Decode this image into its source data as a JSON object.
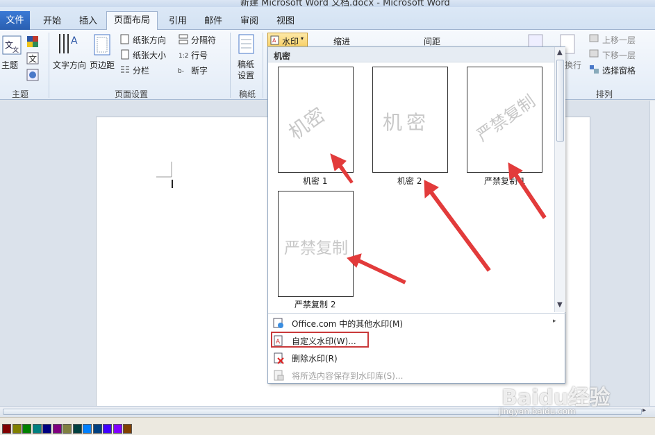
{
  "window": {
    "title": "新建 Microsoft Word 文档.docx - Microsoft Word"
  },
  "tabs": {
    "file": "文件",
    "home": "开始",
    "insert": "插入",
    "page_layout": "页面布局",
    "references": "引用",
    "mailings": "邮件",
    "review": "审阅",
    "view": "视图"
  },
  "ribbon": {
    "theme": {
      "theme_button": "主题",
      "group_label": "主题"
    },
    "page_setup": {
      "text_direction": "文字方向",
      "margins": "页边距",
      "orientation": "纸张方向",
      "size": "纸张大小",
      "columns": "分栏",
      "breaks": "分隔符",
      "line_numbers": "行号",
      "hyphenation": "断字",
      "group_label": "页面设置"
    },
    "draft": {
      "draft_paper": "稿纸\n设置",
      "group_label": "稿纸"
    },
    "page_background": {
      "watermark_button": "水印"
    },
    "paragraph": {
      "indent": "缩进",
      "spacing": "间距"
    },
    "arrange": {
      "bring_forward": "上移一层",
      "send_backward": "下移一层",
      "selection_pane": "选择窗格",
      "wrap_text": "换行",
      "group_label": "排列"
    }
  },
  "watermark_gallery": {
    "category": "机密",
    "items": [
      {
        "label": "机密 1",
        "watermark_text": "机密",
        "style": "diagonal"
      },
      {
        "label": "机密 2",
        "watermark_text": "机密",
        "style": "horizontal"
      },
      {
        "label": "严禁复制 1",
        "watermark_text": "严禁复制",
        "style": "diagonal"
      },
      {
        "label": "严禁复制 2",
        "watermark_text": "严禁复制",
        "style": "horizontal"
      }
    ],
    "menu": [
      {
        "label": "Office.com 中的其他水印(M)",
        "has_submenu": true,
        "enabled": true
      },
      {
        "label": "自定义水印(W)...",
        "has_submenu": false,
        "enabled": true,
        "highlighted": true
      },
      {
        "label": "删除水印(R)",
        "has_submenu": false,
        "enabled": true
      },
      {
        "label": "将所选内容保存到水印库(S)...",
        "has_submenu": false,
        "enabled": false
      }
    ]
  },
  "annotation": {
    "highlight_color": "#c9393a",
    "arrow_color": "#e23b3b"
  },
  "palette": [
    "#800000",
    "#808000",
    "#008000",
    "#008080",
    "#000080",
    "#800080",
    "#808040",
    "#004040",
    "#0080ff",
    "#004080",
    "#4000ff",
    "#8000ff",
    "#804000"
  ],
  "watermark_logo": {
    "brand": "Baidu经验",
    "url": "jingyan.baidu.com"
  }
}
